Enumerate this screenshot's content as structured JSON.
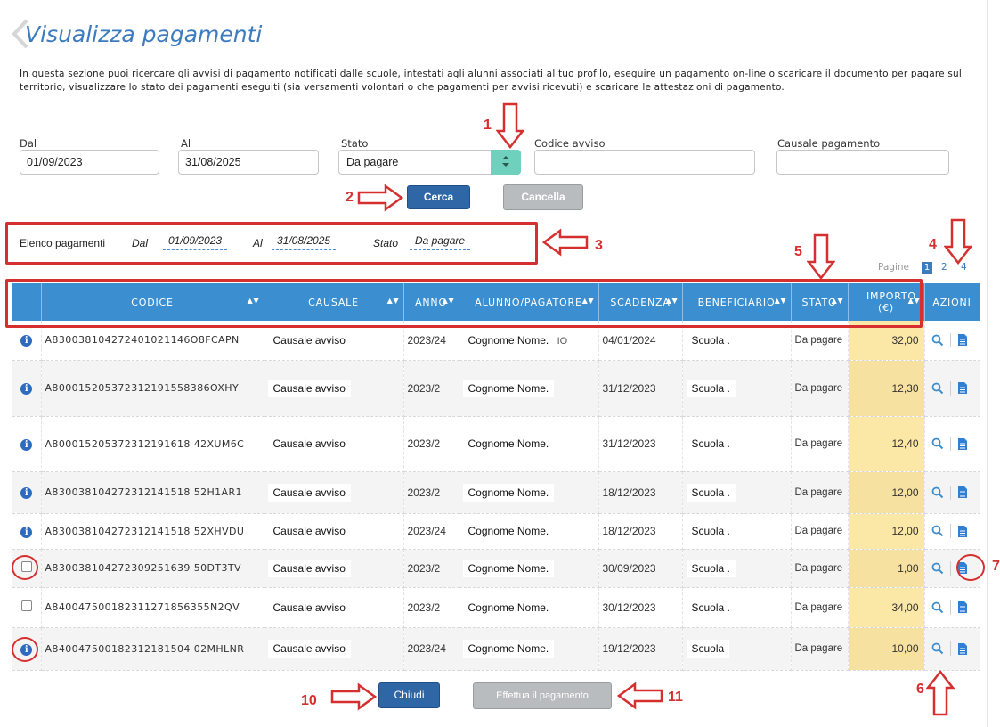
{
  "page": {
    "title": "Visualizza pagamenti",
    "intro": "In questa sezione puoi ricercare gli avvisi di pagamento notificati dalle scuole, intestati agli alunni associati al tuo profilo, eseguire un pagamento on-line o scaricare il documento per pagare sul territorio, visualizzare lo stato dei pagamenti eseguiti (sia versamenti volontari o che pagamenti per avvisi ricevuti) e scaricare le attestazioni di pagamento."
  },
  "filters": {
    "dal_label": "Dal",
    "dal_value": "01/09/2023",
    "al_label": "Al",
    "al_value": "31/08/2025",
    "stato_label": "Stato",
    "stato_value": "Da pagare",
    "codice_label": "Codice avviso",
    "codice_value": "",
    "causale_label": "Causale pagamento",
    "causale_value": "",
    "cerca": "Cerca",
    "cancella": "Cancella"
  },
  "summary": {
    "label": "Elenco pagamenti",
    "dal_label": "Dal",
    "dal_value": "01/09/2023",
    "al_label": "Al",
    "al_value": "31/08/2025",
    "stato_label": "Stato",
    "stato_value": "Da pagare"
  },
  "pager": {
    "label": "Pagine",
    "current": "1",
    "pages": [
      "2",
      "4"
    ]
  },
  "table": {
    "columns": [
      "CODICE",
      "CAUSALE",
      "ANNO",
      "ALUNNO/PAGATORE",
      "SCADENZA",
      "BENEFICIARIO",
      "STATO",
      "IMPORTO (€)",
      "AZIONI"
    ],
    "rows": [
      {
        "code": "A830038104272401021146O8FCAPN",
        "causale": "Causale avviso",
        "anno": "2023/24",
        "alunno": "Cognome Nome.",
        "alunno_suffix": "IO",
        "scadenza": "04/01/2024",
        "beneficiario": "Scuola .",
        "stato": "Da pagare",
        "importo": "32,00",
        "sel": "info"
      },
      {
        "code": "A800015205372312191558386OXHY",
        "causale": "Causale avviso",
        "anno": "2023/2",
        "alunno": "Cognome Nome.",
        "alunno_suffix": "",
        "scadenza": "31/12/2023",
        "beneficiario": "Scuola .",
        "stato": "Da pagare",
        "importo": "12,30",
        "sel": "info"
      },
      {
        "code": "A800015205372312191618 42XUM6C",
        "causale": "Causale avviso",
        "anno": "2023/2",
        "alunno": "Cognome Nome.",
        "alunno_suffix": "",
        "scadenza": "31/12/2023",
        "beneficiario": "Scuola .",
        "stato": "Da pagare",
        "importo": "12,40",
        "sel": "info"
      },
      {
        "code": "A830038104272312141518 52H1AR1",
        "causale": "Causale avviso",
        "anno": "2023/2",
        "alunno": "Cognome Nome.",
        "alunno_suffix": "",
        "scadenza": "18/12/2023",
        "beneficiario": "Scuola .",
        "stato": "Da pagare",
        "importo": "12,00",
        "sel": "info"
      },
      {
        "code": "A830038104272312141518 52XHVDU",
        "causale": "Causale avviso",
        "anno": "2023/24",
        "alunno": "Cognome Nome.",
        "alunno_suffix": "",
        "scadenza": "18/12/2023",
        "beneficiario": "Scuola .",
        "stato": "Da pagare",
        "importo": "12,00",
        "sel": "info"
      },
      {
        "code": "A830038104272309251639 50DT3TV",
        "causale": "Causale avviso",
        "anno": "2023/2",
        "alunno": "Cognome Nome.",
        "alunno_suffix": "",
        "scadenza": "30/09/2023",
        "beneficiario": "Scuola .",
        "stato": "Da pagare",
        "importo": "1,00",
        "sel": "check"
      },
      {
        "code": "A840047500182311271856355N2QV",
        "causale": "Causale avviso",
        "anno": "2023/2",
        "alunno": "Cognome Nome.",
        "alunno_suffix": "",
        "scadenza": "30/12/2023",
        "beneficiario": "Scuola .",
        "stato": "Da pagare",
        "importo": "34,00",
        "sel": "check"
      },
      {
        "code": "A840047500182312181504 02MHLNR",
        "causale": "Causale avviso",
        "anno": "2023/24",
        "alunno": "Cognome Nome.",
        "alunno_suffix": "",
        "scadenza": "19/12/2023",
        "beneficiario": "Scuola",
        "stato": "Da pagare",
        "importo": "10,00",
        "sel": "info"
      }
    ]
  },
  "footer": {
    "chiudi": "Chiudi",
    "paga": "Effettua il pagamento"
  },
  "annotations": {
    "n1": "1",
    "n2": "2",
    "n3": "3",
    "n4": "4",
    "n5": "5",
    "n6": "6",
    "n7": "7",
    "n10": "10",
    "n11": "11"
  },
  "colors": {
    "accent": "#3b8fd1",
    "annotation": "#d62f2f",
    "importo_bg": "#fbe7a6",
    "select_btn": "#6fd0bd"
  }
}
